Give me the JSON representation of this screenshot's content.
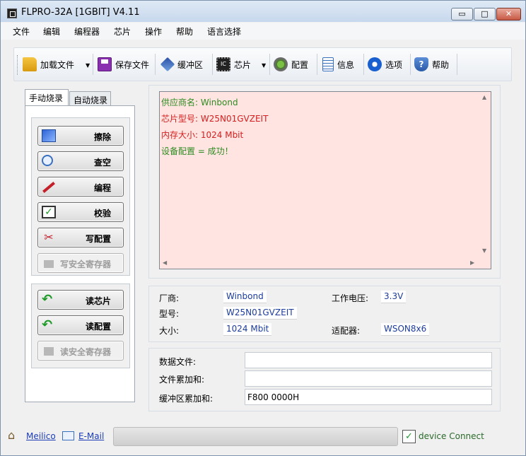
{
  "window": {
    "title": "FLPRO-32A [1GBIT] V4.11",
    "min": "▭",
    "max": "□",
    "close": "✕"
  },
  "menu": [
    "文件",
    "编辑",
    "编程器",
    "芯片",
    "操作",
    "帮助",
    "语言选择"
  ],
  "toolbar": [
    {
      "label": "加载文件",
      "icon": "folder-icon",
      "dropdown": true
    },
    {
      "label": "保存文件",
      "icon": "floppy-disk-icon"
    },
    {
      "label": "缓冲区",
      "icon": "layers-icon"
    },
    {
      "label": "芯片",
      "icon": "ic-chip-icon",
      "dropdown": true
    },
    {
      "label": "配置",
      "icon": "config-gear-icon"
    },
    {
      "label": "信息",
      "icon": "document-info-icon"
    },
    {
      "label": "选项",
      "icon": "options-gear-icon"
    },
    {
      "label": "帮助",
      "icon": "help-shield-icon"
    }
  ],
  "tabs": {
    "manual": "手动烧录",
    "auto": "自动烧录"
  },
  "ops_group1": [
    {
      "label": "擦除",
      "icon": "erase-brush-icon",
      "enabled": true
    },
    {
      "label": "查空",
      "icon": "magnifier-icon",
      "enabled": true
    },
    {
      "label": "编程",
      "icon": "pen-icon",
      "enabled": true
    },
    {
      "label": "校验",
      "icon": "check-icon",
      "enabled": true
    },
    {
      "label": "写配置",
      "icon": "tools-icon",
      "enabled": true
    },
    {
      "label": "写安全寄存器",
      "icon": "lock-icon",
      "enabled": false
    }
  ],
  "ops_group2": [
    {
      "label": "读芯片",
      "icon": "read-arrow-icon",
      "enabled": true
    },
    {
      "label": "读配置",
      "icon": "read-config-icon",
      "enabled": true
    },
    {
      "label": "读安全寄存器",
      "icon": "read-secure-icon",
      "enabled": false
    }
  ],
  "log": [
    {
      "text": "供应商名: Winbond",
      "color": "#2e8b22"
    },
    {
      "text": "芯片型号: W25N01GVZEIT",
      "color": "#d42020"
    },
    {
      "text": "内存大小: 1024 Mbit",
      "color": "#d42020"
    },
    {
      "text": "设备配置 = 成功！",
      "color": "#2e8b22"
    }
  ],
  "chip_info": {
    "vendor_label": "厂商:",
    "vendor": "Winbond",
    "model_label": "型号:",
    "model": "W25N01GVZEIT",
    "size_label": "大小:",
    "size": "1024 Mbit",
    "voltage_label": "工作电压:",
    "voltage": "3.3V",
    "adapter_label": "适配器:",
    "adapter": "WSON8x6"
  },
  "files": {
    "data_file_label": "数据文件:",
    "data_file": "",
    "file_checksum_label": "文件累加和:",
    "file_checksum": "",
    "buffer_checksum_label": "缓冲区累加和:",
    "buffer_checksum": "F800 0000H"
  },
  "status": {
    "meilico": "Meilico",
    "email": "E-Mail",
    "connection": "device Connect",
    "progress": 0
  }
}
